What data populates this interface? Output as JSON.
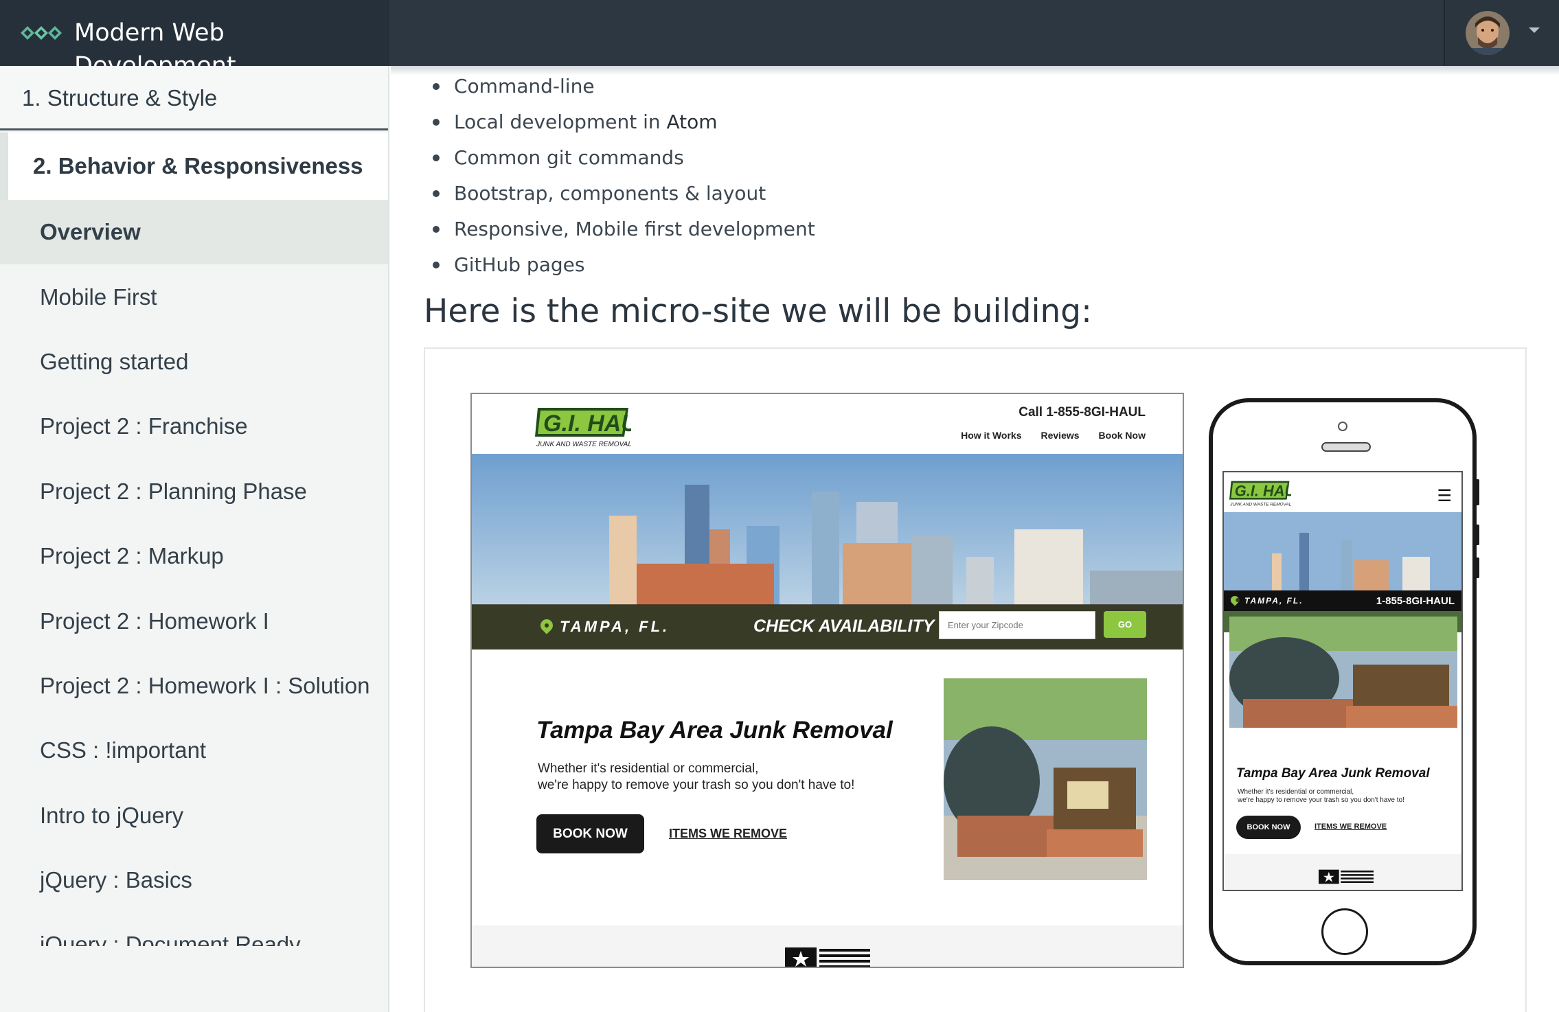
{
  "header": {
    "app_title": "Modern Web Development",
    "logo_icon": "diamond-chain-icon",
    "user_menu_icon": "caret-down-icon"
  },
  "sidebar": {
    "section_1": "1. Structure & Style",
    "section_2": "2. Behavior & Responsiveness",
    "lessons": [
      {
        "label": "Overview",
        "active": true
      },
      {
        "label": "Mobile First"
      },
      {
        "label": "Getting started"
      },
      {
        "label": "Project 2 : Franchise"
      },
      {
        "label": "Project 2 : Planning Phase"
      },
      {
        "label": "Project 2 : Markup"
      },
      {
        "label": "Project 2 : Homework I"
      },
      {
        "label": "Project 2 : Homework I : Solution"
      },
      {
        "label": "CSS : !important"
      },
      {
        "label": "Intro to jQuery"
      },
      {
        "label": "jQuery : Basics"
      },
      {
        "label": "jQuery : Document Ready"
      }
    ]
  },
  "content": {
    "bullets": [
      {
        "text": "Command-line"
      },
      {
        "text": "Local development in ",
        "bold": "Atom"
      },
      {
        "text": "Common git commands"
      },
      {
        "text": "Bootstrap, components & layout"
      },
      {
        "text": "Responsive, Mobile first development"
      },
      {
        "text": "GitHub pages"
      }
    ],
    "heading": "Here is the micro-site we will be building:"
  },
  "mockup": {
    "logo_text": "G.I. HAUL",
    "logo_tagline": "JUNK AND WASTE REMOVAL",
    "call": "Call 1-855-8GI-HAUL",
    "nav": [
      "How it Works",
      "Reviews",
      "Book Now"
    ],
    "city": "TAMPA, FL.",
    "check": "CHECK AVAILABILITY",
    "zip_placeholder": "Enter your Zipcode",
    "go": "GO",
    "headline": "Tampa Bay Area Junk Removal",
    "paragraph_1": "Whether it's residential or commercial,",
    "paragraph_2": "we're happy to remove your trash so you don't have to!",
    "book": "BOOK NOW",
    "items": "ITEMS WE REMOVE",
    "phone_number": "1-855-8GI-HAUL"
  },
  "colors": {
    "topbar": "#2b3640",
    "accent_green": "#8dc63f",
    "sidebar_bg": "#f3f5f4"
  }
}
